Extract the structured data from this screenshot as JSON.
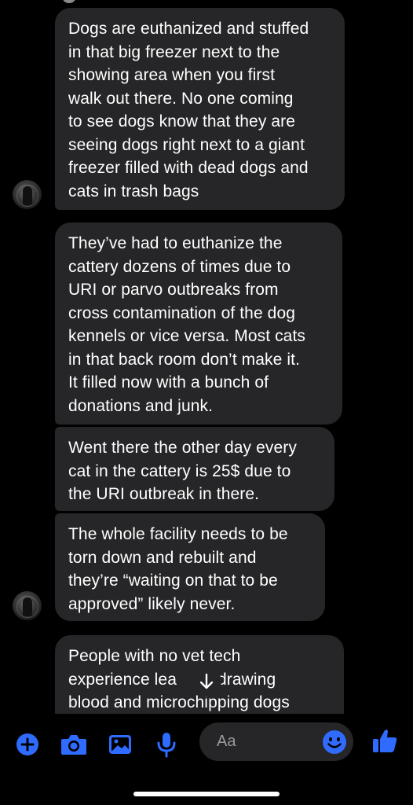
{
  "accent_color": "#2f6bff",
  "messages": [
    {
      "lines": [
        "Dogs are euthanized and stuffed",
        "in that big freezer next to the",
        "showing area when you first",
        "walk out there. No one coming",
        "to see dogs know that they are",
        "seeing dogs right next to a giant",
        "freezer filled with dead dogs and",
        "cats in trash bags"
      ]
    },
    {
      "lines": [
        "They’ve had to euthanize the",
        "cattery dozens of times due to",
        "URI or parvo outbreaks from",
        "cross contamination of the dog",
        "kennels or vice versa. Most cats",
        "in that back room don’t make it.",
        "It filled now with a bunch of",
        "donations and junk."
      ]
    },
    {
      "lines": [
        "Went there the other day every",
        "cat in the cattery is 25$ due to",
        "the URI outbreak in there."
      ]
    },
    {
      "lines": [
        "The whole facility needs to be",
        "torn down and rebuilt and",
        "they’re “waiting on that to be",
        "approved” likely never."
      ]
    },
    {
      "lines": [
        "People with no vet tech",
        "experience lea",
        "blood and microchipping dogs"
      ],
      "line2_tail": "drawing",
      "line3_note": "partially obscured by scroll button"
    }
  ],
  "composer": {
    "placeholder": "Aa",
    "icons": [
      "plus-icon",
      "camera-icon",
      "image-icon",
      "microphone-icon",
      "emoji-icon",
      "thumbs-up-icon"
    ]
  }
}
